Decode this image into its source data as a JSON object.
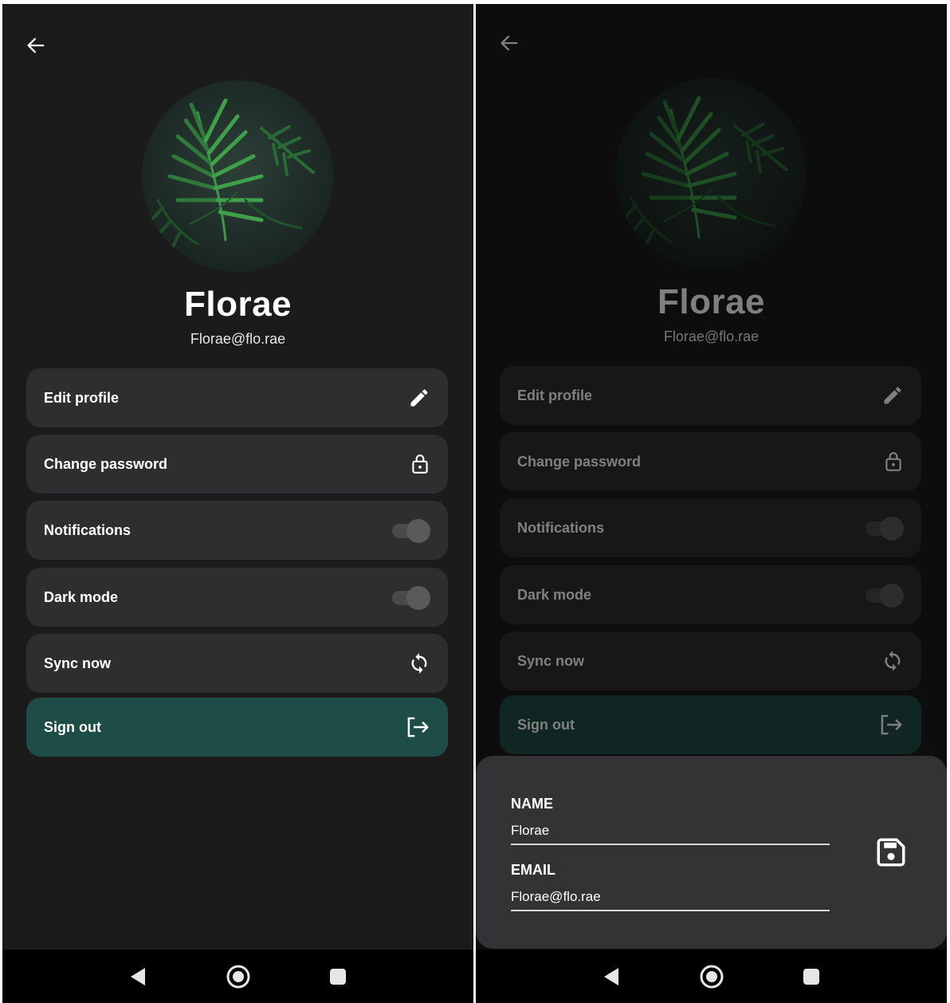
{
  "profile": {
    "name": "Florae",
    "email": "Florae@flo.rae"
  },
  "menu": {
    "edit_profile": "Edit profile",
    "change_password": "Change password",
    "notifications": "Notifications",
    "dark_mode": "Dark mode",
    "sync_now": "Sync now",
    "sign_out": "Sign out"
  },
  "toggles": {
    "notifications_on": true,
    "dark_mode_on": true
  },
  "edit_sheet": {
    "name_label": "NAME",
    "name_value": "Florae",
    "email_label": "EMAIL",
    "email_value": "Florae@flo.rae"
  },
  "icons": [
    "back-arrow-icon",
    "pencil-icon",
    "lock-icon",
    "sync-icon",
    "sign-out-icon",
    "save-icon",
    "nav-back-icon",
    "nav-home-icon",
    "nav-recents-icon"
  ],
  "colors": {
    "background": "#1b1b1c",
    "card": "#2e2e30",
    "sign_out": "#1e4d47",
    "sheet": "#333335"
  }
}
